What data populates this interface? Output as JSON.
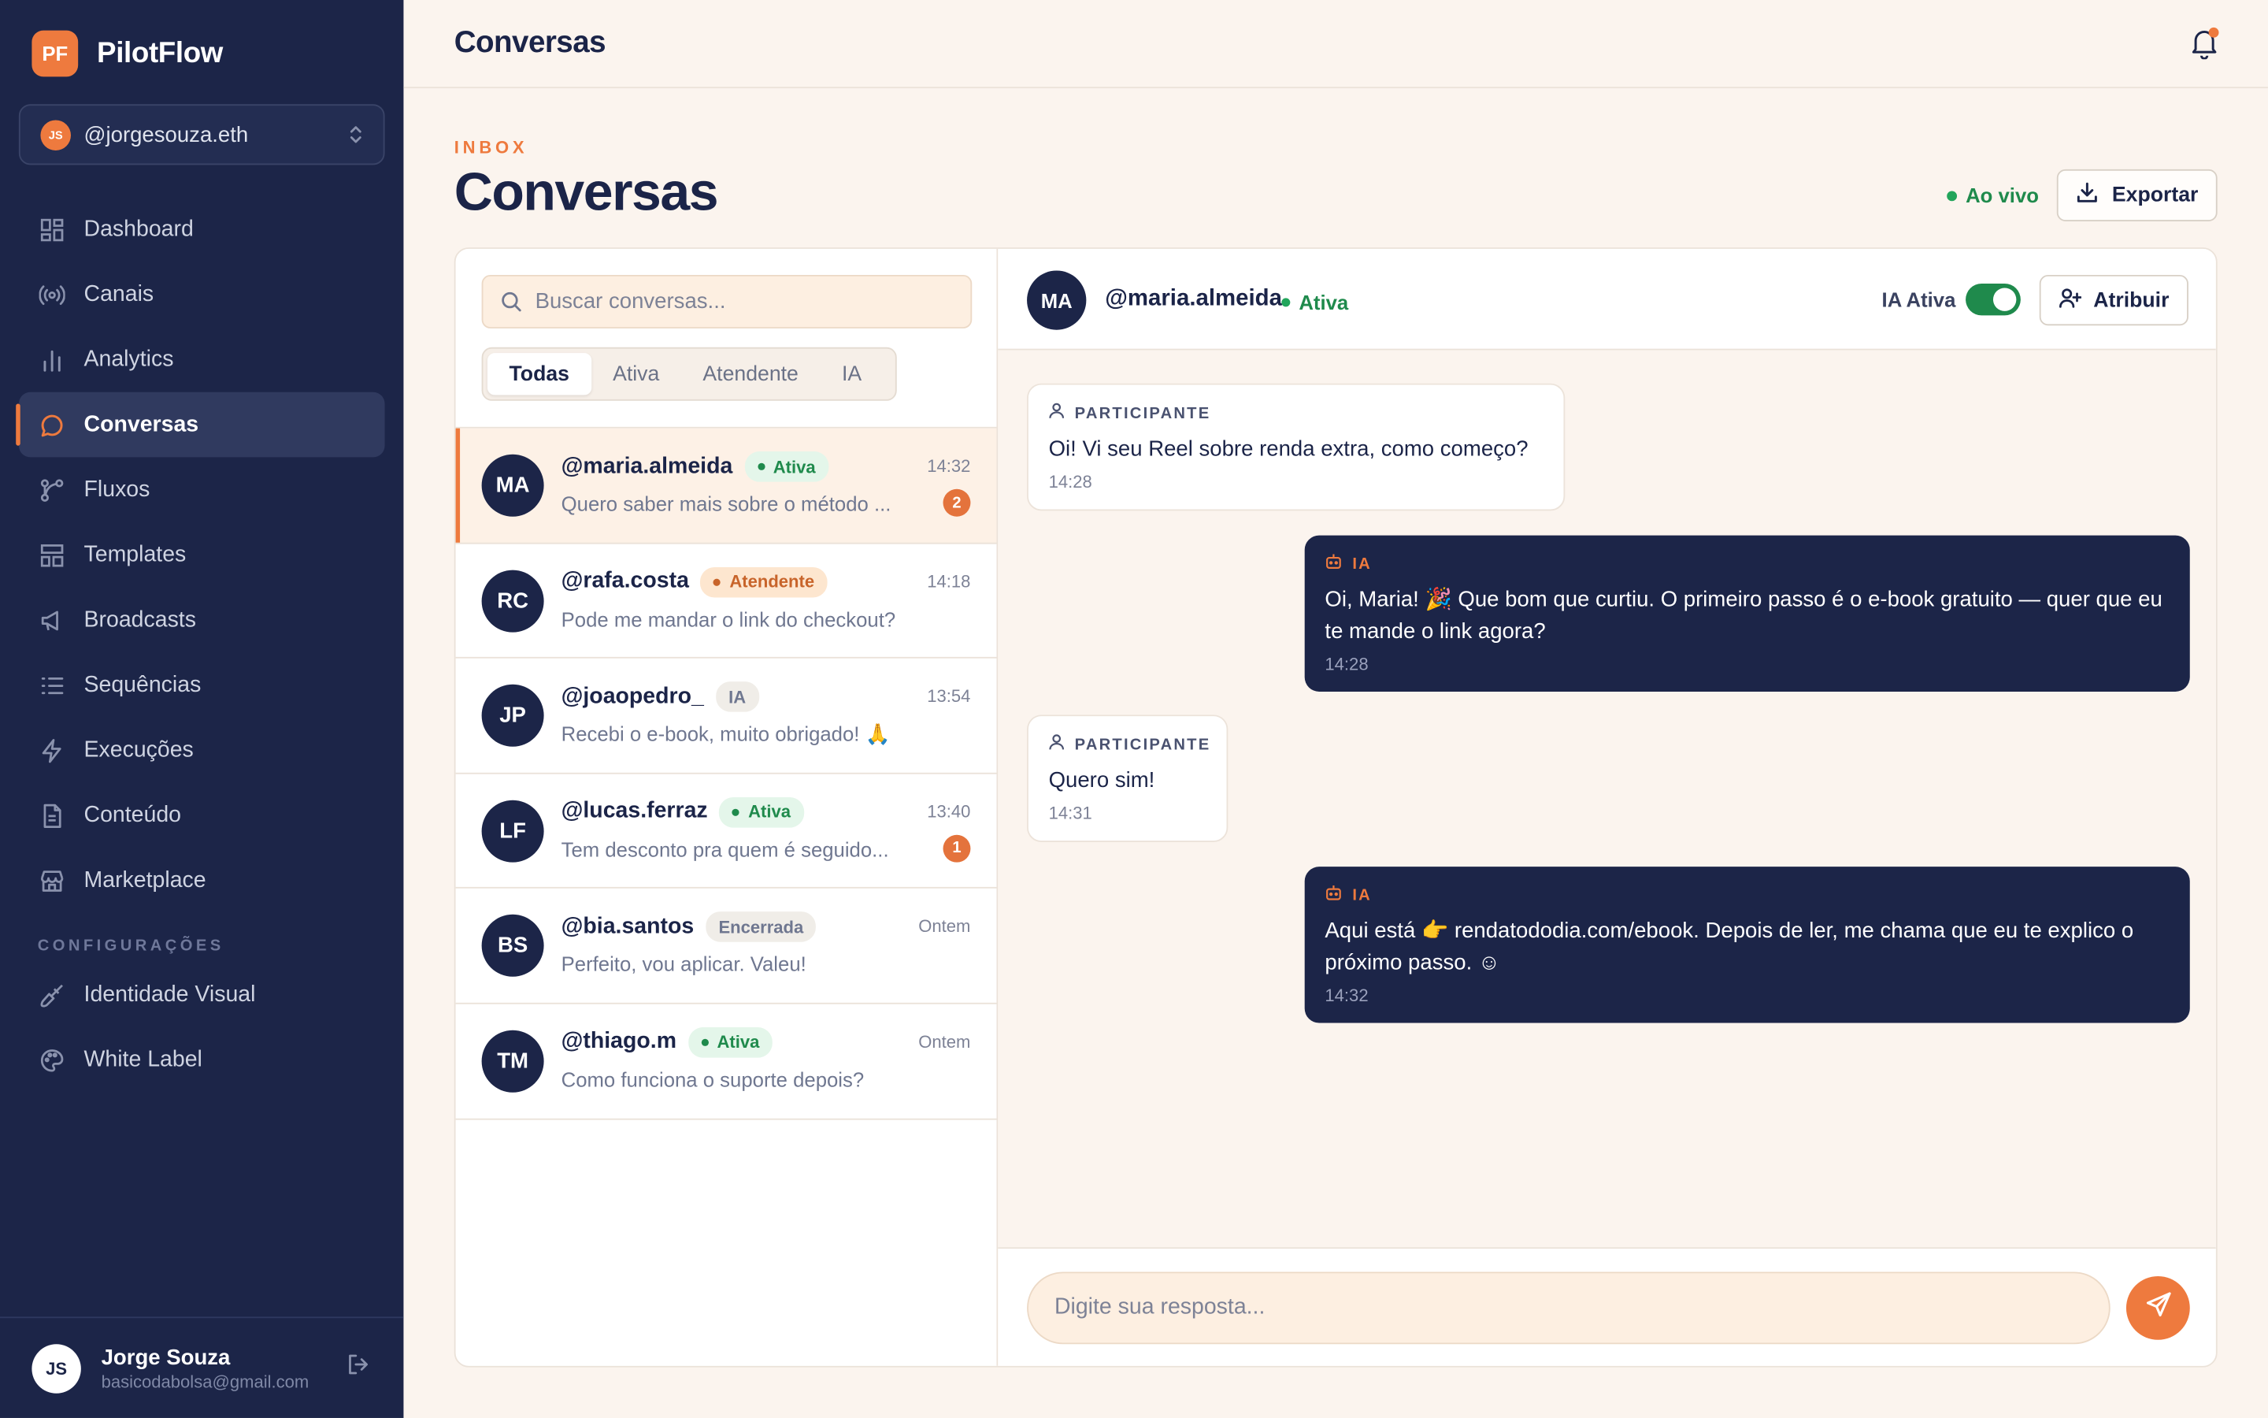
{
  "brand": {
    "logo": "PF",
    "name": "PilotFlow",
    "accent": "#ee7a3e",
    "navy": "#1c2548"
  },
  "account": {
    "initials": "JS",
    "handle": "@jorgesouza.eth"
  },
  "nav": [
    {
      "label": "Dashboard",
      "icon": "dashboard-icon"
    },
    {
      "label": "Canais",
      "icon": "broadcast-icon"
    },
    {
      "label": "Analytics",
      "icon": "bar-chart-icon"
    },
    {
      "label": "Conversas",
      "icon": "chat-icon",
      "active": true
    },
    {
      "label": "Fluxos",
      "icon": "flow-icon"
    },
    {
      "label": "Templates",
      "icon": "templates-icon"
    },
    {
      "label": "Broadcasts",
      "icon": "megaphone-icon"
    },
    {
      "label": "Sequências",
      "icon": "list-icon"
    },
    {
      "label": "Execuções",
      "icon": "bolt-icon"
    },
    {
      "label": "Conteúdo",
      "icon": "document-icon"
    },
    {
      "label": "Marketplace",
      "icon": "store-icon"
    }
  ],
  "settings": {
    "section": "CONFIGURAÇÕES",
    "items": [
      {
        "label": "Identidade Visual",
        "icon": "brush-icon"
      },
      {
        "label": "White Label",
        "icon": "palette-icon"
      }
    ]
  },
  "user": {
    "initials": "JS",
    "name": "Jorge Souza",
    "email": "basicodabolsa@gmail.com"
  },
  "header": {
    "title": "Conversas",
    "eyebrow": "INBOX",
    "page_title": "Conversas",
    "live": "Ao vivo",
    "export": "Exportar"
  },
  "list": {
    "search_placeholder": "Buscar conversas...",
    "filters": [
      "Todas",
      "Ativa",
      "Atendente",
      "IA"
    ],
    "conversations": [
      {
        "initials": "MA",
        "name": "@maria.almeida",
        "status": "Ativa",
        "status_type": "ativa",
        "time": "14:32",
        "preview": "Quero saber mais sobre o método ...",
        "unread": "2",
        "active": true
      },
      {
        "initials": "RC",
        "name": "@rafa.costa",
        "status": "Atendente",
        "status_type": "atend",
        "time": "14:18",
        "preview": "Pode me mandar o link do checkout?",
        "unread": ""
      },
      {
        "initials": "JP",
        "name": "@joaopedro_",
        "status": "IA",
        "status_type": "ia",
        "time": "13:54",
        "preview": "Recebi o e-book, muito obrigado! 🙏",
        "unread": ""
      },
      {
        "initials": "LF",
        "name": "@lucas.ferraz",
        "status": "Ativa",
        "status_type": "ativa",
        "time": "13:40",
        "preview": "Tem desconto pra quem é seguido...",
        "unread": "1"
      },
      {
        "initials": "BS",
        "name": "@bia.santos",
        "status": "Encerrada",
        "status_type": "enc",
        "time": "Ontem",
        "preview": "Perfeito, vou aplicar. Valeu!",
        "unread": ""
      },
      {
        "initials": "TM",
        "name": "@thiago.m",
        "status": "Ativa",
        "status_type": "ativa",
        "time": "Ontem",
        "preview": "Como funciona o suporte depois?",
        "unread": ""
      }
    ]
  },
  "chat": {
    "initials": "MA",
    "name": "@maria.almeida",
    "status": "Ativa",
    "ia_label": "IA Ativa",
    "ia_enabled": true,
    "assign": "Atribuir",
    "messages": [
      {
        "role": "PARTICIPANTE",
        "dir": "in",
        "text": "Oi! Vi seu Reel sobre renda extra, como começo?",
        "time": "14:28"
      },
      {
        "role": "IA",
        "dir": "out",
        "text": "Oi, Maria! 🎉 Que bom que curtiu. O primeiro passo é o e-book gratuito — quer que eu te mande o link agora?",
        "time": "14:28"
      },
      {
        "role": "PARTICIPANTE",
        "dir": "in",
        "text": "Quero sim!",
        "time": "14:31"
      },
      {
        "role": "IA",
        "dir": "out",
        "text": "Aqui está 👉 rendatododia.com/ebook. Depois de ler, me chama que eu te explico o próximo passo. ☺",
        "time": "14:32"
      }
    ],
    "reply_placeholder": "Digite sua resposta..."
  }
}
